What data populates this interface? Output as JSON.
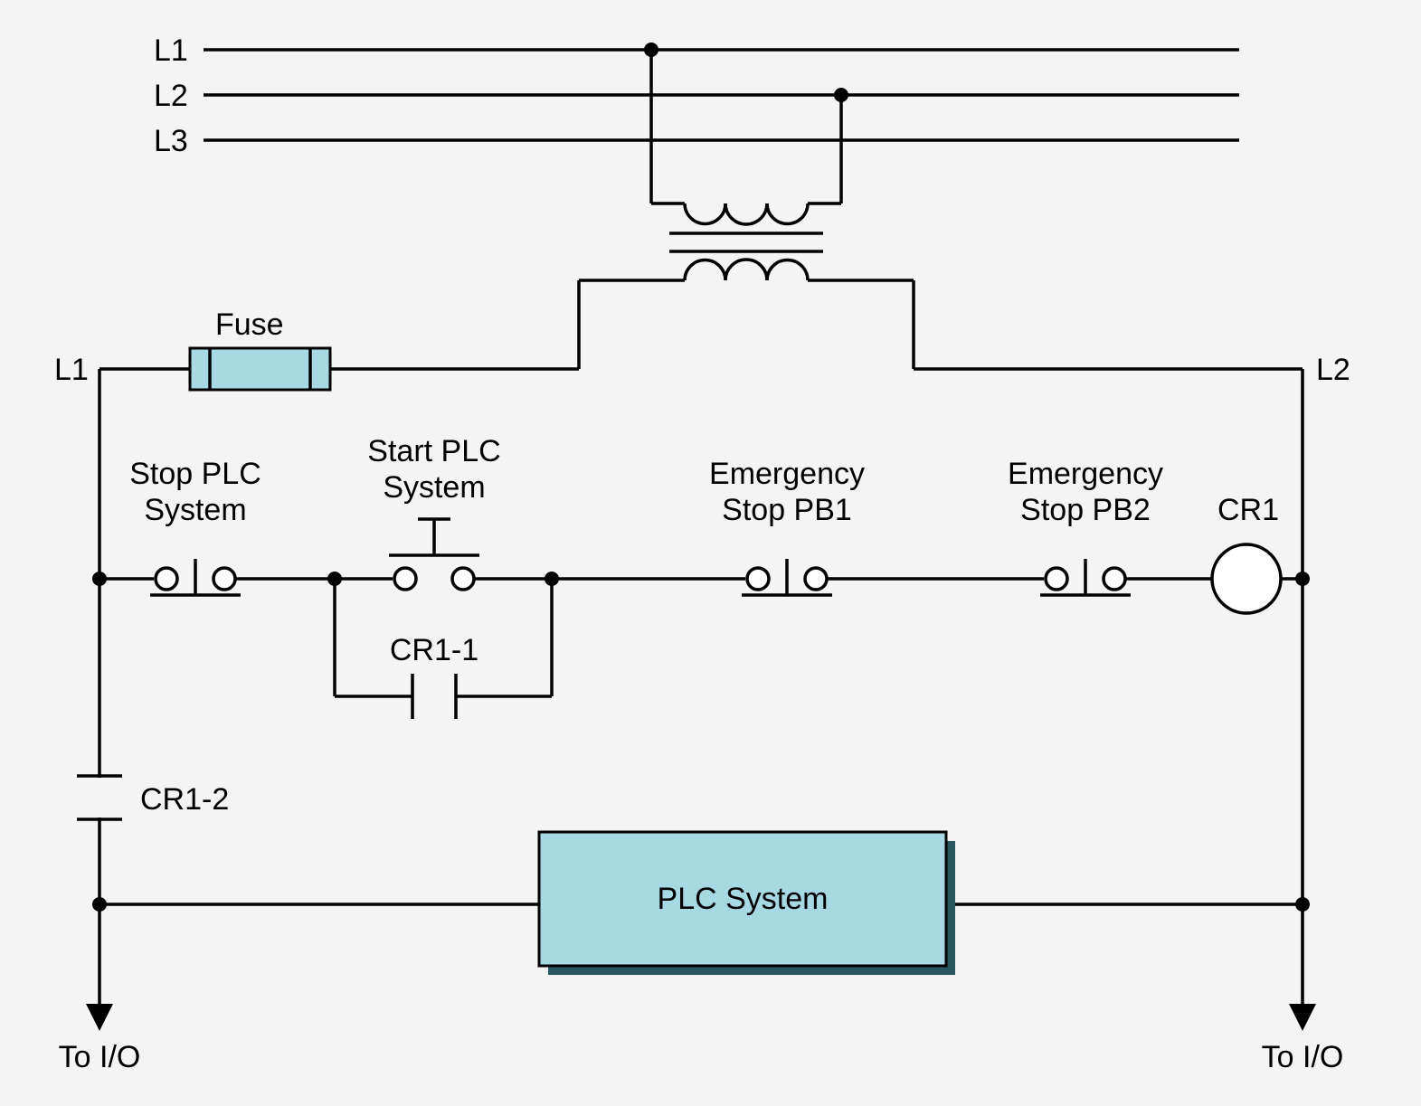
{
  "phases": {
    "l1": "L1",
    "l2": "L2",
    "l3": "L3"
  },
  "fuse": {
    "label": "Fuse"
  },
  "rails": {
    "left": "L1",
    "right": "L2"
  },
  "components": {
    "stop_plc": {
      "line1": "Stop PLC",
      "line2": "System"
    },
    "start_plc": {
      "line1": "Start PLC",
      "line2": "System"
    },
    "estop1": {
      "line1": "Emergency",
      "line2": "Stop PB1"
    },
    "estop2": {
      "line1": "Emergency",
      "line2": "Stop PB2"
    },
    "cr1": "CR1",
    "cr1_1": "CR1-1",
    "cr1_2": "CR1-2",
    "plc_box": "PLC System",
    "to_io": "To I/O"
  }
}
